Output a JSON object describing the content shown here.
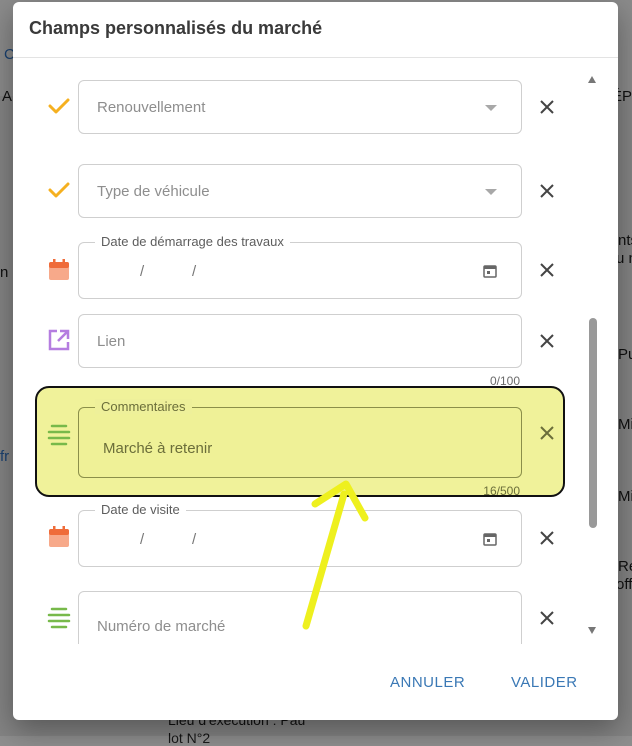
{
  "background": {
    "fragments": [
      "C",
      "A",
      "ÉP",
      "n",
      "nts",
      "u n",
      "Pu",
      "Mi",
      "Mi",
      "fr",
      "Ré",
      "off",
      "Lieu d'exécution : Pau",
      "lot N°2"
    ]
  },
  "dialog": {
    "title": "Champs personnalisés du marché",
    "fields": [
      {
        "icon": "check-icon",
        "type": "select",
        "placeholder": "Renouvellement"
      },
      {
        "icon": "check-icon",
        "type": "select",
        "placeholder": "Type de véhicule"
      },
      {
        "icon": "calendar-icon",
        "type": "date",
        "label": "Date de démarrage des travaux",
        "date_sep": "/"
      },
      {
        "icon": "external-link-icon",
        "type": "text",
        "placeholder": "Lien",
        "counter": "0/100"
      },
      {
        "icon": "text-lines-icon",
        "type": "textarea",
        "label": "Commentaires",
        "value": "Marché à retenir",
        "counter": "16/500"
      },
      {
        "icon": "calendar-icon",
        "type": "date",
        "label": "Date de visite",
        "date_sep": "/"
      },
      {
        "icon": "text-lines-icon",
        "type": "text",
        "placeholder": "Numéro de marché"
      }
    ],
    "actions": {
      "cancel": "ANNULER",
      "confirm": "VALIDER"
    }
  },
  "colors": {
    "check": "#f5b020",
    "calendar": "#ef6c3a",
    "link": "#b57de0",
    "lines": "#77b94a",
    "action": "#3a78b5",
    "highlight": "#ebee78",
    "arrow": "#eef01e"
  }
}
